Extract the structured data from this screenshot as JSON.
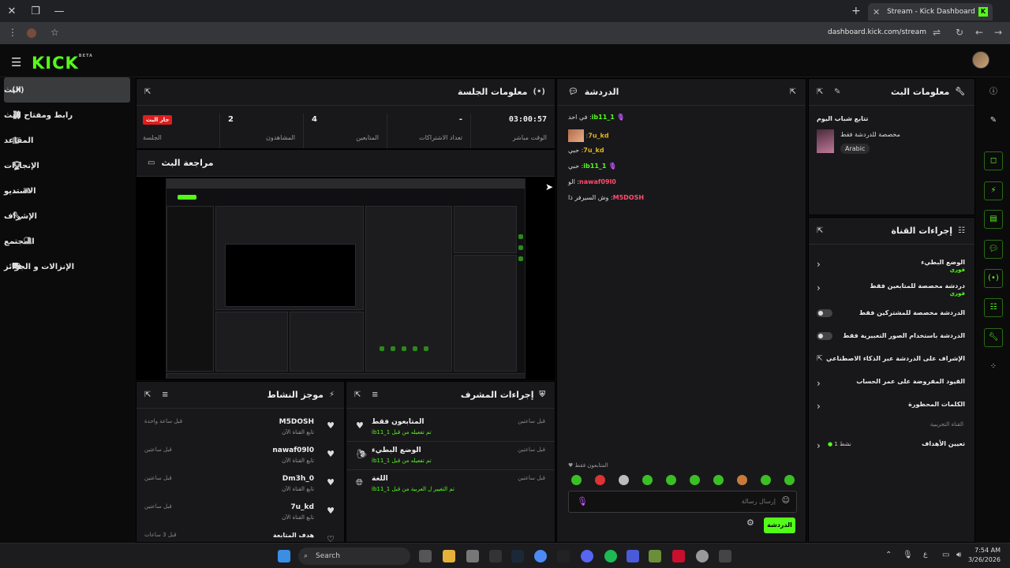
{
  "browser": {
    "tab_title": "Stream - Kick Dashboard",
    "url": "dashboard.kick.com/stream"
  },
  "header": {
    "logo": "KICK",
    "beta": "BETA"
  },
  "nav": {
    "items": [
      {
        "label": "البث"
      },
      {
        "label": "رابط ومفتاح البث"
      },
      {
        "label": "المقاعد"
      },
      {
        "label": "الإنجازات"
      },
      {
        "label": "الاستديو"
      },
      {
        "label": "الإشراف"
      },
      {
        "label": "المجتمع"
      },
      {
        "label": "الإنزالات و الجوائز"
      }
    ]
  },
  "session": {
    "title": "معلومات الجلسة",
    "stats": [
      {
        "value": "03:00:57",
        "label": "الوقت مباشر"
      },
      {
        "value": "-",
        "label": "تعداد الاشتراكات"
      },
      {
        "value": "4",
        "label": "المتابعين"
      },
      {
        "value": "2",
        "label": "المشاهدون"
      },
      {
        "value": "جار البث",
        "label": "الجلسة"
      }
    ]
  },
  "preview": {
    "title": "مراجعة البث"
  },
  "activity": {
    "title": "موجز النشاط",
    "items": [
      {
        "name": "M5DOSH",
        "sub": "تابع القناة الآن",
        "time": "قبل ساعة واحدة"
      },
      {
        "name": "nawaf09l0",
        "sub": "تابع القناة الآن",
        "time": "قبل ساعتين"
      },
      {
        "name": "Dm3h_0",
        "sub": "تابع القناة الآن",
        "time": "قبل ساعتين"
      },
      {
        "name": "7u_kd",
        "sub": "تابع القناة الآن",
        "time": "قبل ساعتين"
      },
      {
        "name": "هدف المتابعة",
        "sub": "",
        "time": "قبل 3 ساعات"
      }
    ]
  },
  "mod": {
    "title": "إجراءات المشرف",
    "items": [
      {
        "title": "المتابعون فقط",
        "sub": "تم تفعيله من قبل ib11_1",
        "time": "قبل ساعتين"
      },
      {
        "title": "الوضع البطيء",
        "sub": "تم تفعيله من قبل ib11_1",
        "time": "قبل ساعتين"
      },
      {
        "title": "اللغة",
        "sub": "تم التغيير ل العربية من قبل ib11_1",
        "time": "قبل ساعتين"
      }
    ]
  },
  "chat": {
    "title": "الدردشة",
    "messages": [
      {
        "user": "ib11_1",
        "text": "في احد",
        "color": "#53fc18"
      },
      {
        "user": "7u_kd",
        "text": "",
        "color": "#e0b51a"
      },
      {
        "user": "7u_kd",
        "text": "حبي",
        "color": "#e0b51a"
      },
      {
        "user": "ib11_1",
        "text": "حبي",
        "color": "#53fc18"
      },
      {
        "user": "nawaf09l0",
        "text": "الو",
        "color": "#ff4d6d"
      },
      {
        "user": "M5DOSH",
        "text": "وش السيرفر ذا",
        "color": "#ff4d6d"
      }
    ],
    "mode": "المتابعون فقط",
    "placeholder": "إرسال رسالة",
    "send": "الدردشة"
  },
  "stream_info": {
    "title": "معلومات البث",
    "stream_title": "تتابع شباب اليوم",
    "category": "مخصصة للدردشة فقط",
    "language": "Arabic"
  },
  "channel": {
    "title": "إجراءات القناة",
    "items": [
      {
        "title": "الوضع البطيء",
        "sub": "فوري",
        "type": "chevron"
      },
      {
        "title": "دردشة مخصصة للمتابعين فقط",
        "sub": "فوري",
        "type": "chevron"
      },
      {
        "title": "الدردشة مخصصة للمشتركين فقط",
        "sub": "",
        "type": "toggle"
      },
      {
        "title": "الدردشة باستخدام الصور التعبيرية فقط",
        "sub": "",
        "type": "toggle"
      },
      {
        "title": "الإشراف على الدردشة عبر الذكاء الاصطناعي",
        "sub": "",
        "type": "link"
      },
      {
        "title": "القيود المفروضة على عمر الحساب",
        "sub": "",
        "type": "chevron"
      },
      {
        "title": "الكلمات المحظورة",
        "sub": "",
        "type": "chevron"
      }
    ],
    "section": "القناة التجريبية",
    "goals_label": "تعيين الأهداف",
    "goals_value": "نشط 1"
  },
  "taskbar": {
    "search": "Search",
    "time": "7:54 AM",
    "date": "3/26/2026",
    "lang": "ع"
  }
}
